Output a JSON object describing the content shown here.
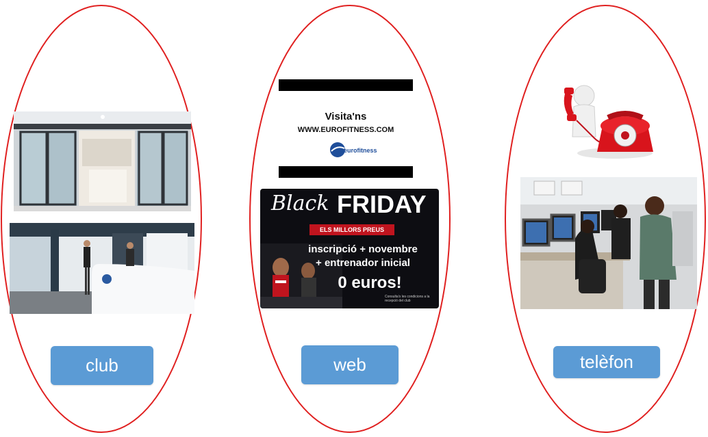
{
  "channels": [
    {
      "key": "club",
      "label": "club"
    },
    {
      "key": "web",
      "label": "web"
    },
    {
      "key": "phone",
      "label": "telèfon"
    }
  ],
  "web_promo": {
    "visit_title": "Visita'ns",
    "url": "WWW.EUROFITNESS.COM",
    "logo_text": "eurofitness",
    "bf_black": "Black",
    "bf_friday": "FRIDAY",
    "bf_tagline": "ELS MILLORS PREUS",
    "bf_line1": "inscripció + novembre",
    "bf_line2": "+ entrenador inicial",
    "bf_price": "0 euros!",
    "bf_footnote": "Consulta's les condicions a la recepció del club"
  },
  "colors": {
    "oval_stroke": "#e02020",
    "button_fill": "#5b9bd5",
    "button_text": "#ffffff",
    "promo_red": "#c0141e"
  }
}
